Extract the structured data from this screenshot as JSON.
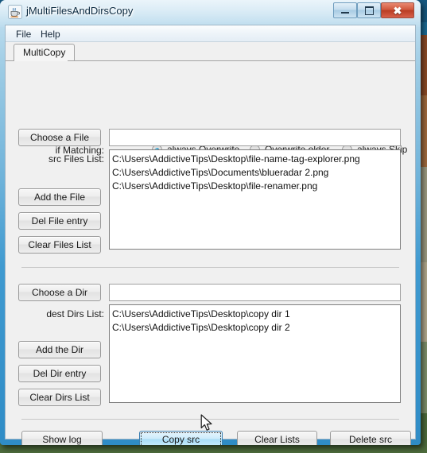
{
  "window": {
    "title": "jMultiFilesAndDirsCopy",
    "app_icon": "java-coffee-cup-icon",
    "controls": {
      "minimize": "–",
      "maximize": "□",
      "close": "✖"
    }
  },
  "menubar": {
    "items": [
      {
        "label": "File"
      },
      {
        "label": "Help"
      }
    ]
  },
  "tabs": [
    {
      "label": "MultiCopy",
      "selected": true
    }
  ],
  "matching": {
    "label": "if Matching:",
    "options": [
      {
        "label": "always Overwrite",
        "selected": true
      },
      {
        "label": "Overwrite older",
        "selected": false
      },
      {
        "label": "always Skip",
        "selected": false
      }
    ]
  },
  "files_section": {
    "choose_button": "Choose a File",
    "choose_field_value": "",
    "list_label": "src Files List:",
    "list_items": [
      "C:\\Users\\AddictiveTips\\Desktop\\file-name-tag-explorer.png",
      "C:\\Users\\AddictiveTips\\Documents\\blueradar 2.png",
      "C:\\Users\\AddictiveTips\\Desktop\\file-renamer.png"
    ],
    "buttons": [
      {
        "label": "Add the File"
      },
      {
        "label": "Del File entry"
      },
      {
        "label": "Clear Files List"
      }
    ]
  },
  "dirs_section": {
    "choose_button": "Choose a Dir",
    "choose_field_value": "",
    "list_label": "dest Dirs List:",
    "list_items": [
      "C:\\Users\\AddictiveTips\\Desktop\\copy dir 1",
      "C:\\Users\\AddictiveTips\\Desktop\\copy dir 2"
    ],
    "buttons": [
      {
        "label": "Add the Dir"
      },
      {
        "label": "Del Dir entry"
      },
      {
        "label": "Clear Dirs List"
      }
    ]
  },
  "action_bar": {
    "buttons": [
      {
        "label": "Show log",
        "state": "normal"
      },
      {
        "label": "Copy src",
        "state": "hover-focused"
      },
      {
        "label": "Clear Lists",
        "state": "normal"
      },
      {
        "label": "Delete src",
        "state": "normal"
      }
    ]
  },
  "colors": {
    "frame_blue": "#3f9ad0",
    "close_red": "#b93d24",
    "radio_accent": "#1b7fb0",
    "hover_blue": "#a8dcf6",
    "focus_border": "#3c7fb1"
  }
}
